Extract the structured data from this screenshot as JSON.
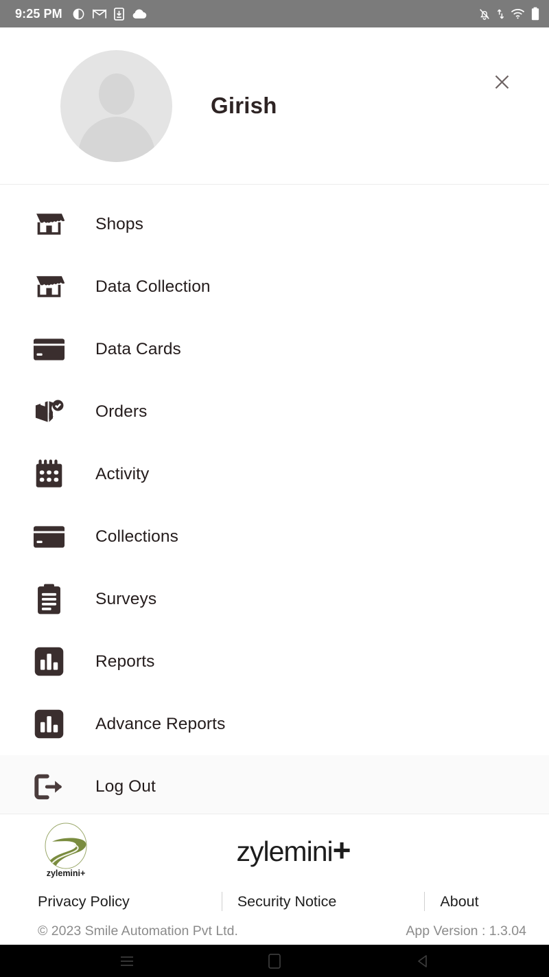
{
  "statusbar": {
    "time": "9:25 PM",
    "left_icons": [
      "contrast-circle-icon",
      "gmail-icon",
      "download-to-device-icon",
      "cloud-icon"
    ],
    "right_icons": [
      "notifications-off-icon",
      "data-transfer-icon",
      "wifi-icon",
      "battery-icon"
    ],
    "background": "#7b7b7b"
  },
  "header": {
    "user_name": "Girish",
    "avatar_name": "user-avatar-placeholder",
    "close_label": "×"
  },
  "menu": {
    "items": [
      {
        "label": "Shops",
        "icon": "store-icon"
      },
      {
        "label": "Data Collection",
        "icon": "store-icon"
      },
      {
        "label": "Data Cards",
        "icon": "credit-card-icon"
      },
      {
        "label": "Orders",
        "icon": "package-check-icon"
      },
      {
        "label": "Activity",
        "icon": "calendar-icon"
      },
      {
        "label": "Collections",
        "icon": "credit-card-icon"
      },
      {
        "label": "Surveys",
        "icon": "clipboard-icon"
      },
      {
        "label": "Reports",
        "icon": "bar-chart-icon"
      },
      {
        "label": "Advance Reports",
        "icon": "bar-chart-icon"
      },
      {
        "label": "Log Out",
        "icon": "logout-icon"
      }
    ]
  },
  "footer": {
    "logo_caption": "zylemini+",
    "brand_name": "zylemini",
    "brand_plus": "+",
    "links": [
      "Privacy Policy",
      "Security Notice",
      "About"
    ],
    "copyright": "© 2023 Smile Automation Pvt Ltd.",
    "app_version": "App Version : 1.3.04",
    "logo_color": "#7a8c3f"
  },
  "navbar": {
    "buttons": [
      "recents-button",
      "home-button",
      "back-button"
    ]
  },
  "colors": {
    "icon_dark": "#3a2e2e",
    "text_dark": "#241c1c",
    "muted": "#8b8b8b",
    "divider": "#ececec"
  }
}
